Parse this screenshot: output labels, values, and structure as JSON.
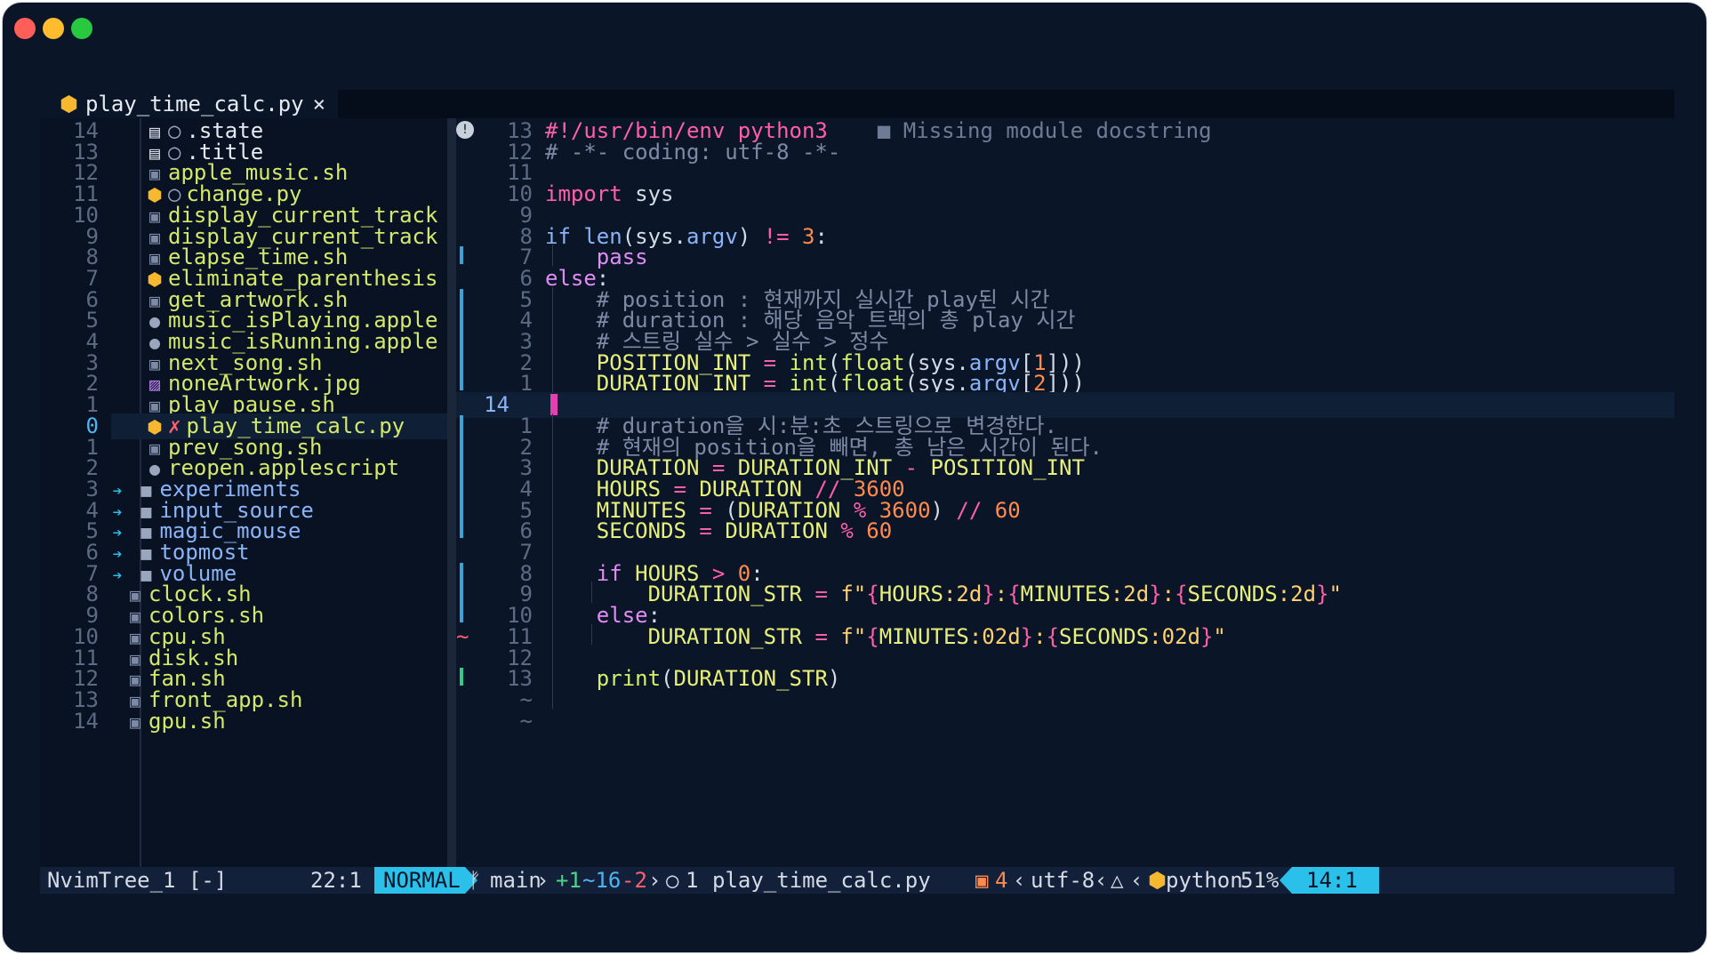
{
  "window": {
    "controls": [
      "close",
      "minimize",
      "zoom"
    ]
  },
  "tab": {
    "file": "play_time_calc.py",
    "close_icon": "×"
  },
  "tree": {
    "rows": [
      {
        "ln": "14",
        "icon": "file-icon",
        "git": "○",
        "name": ".state",
        "color": "#e6ebf2"
      },
      {
        "ln": "13",
        "icon": "file-icon",
        "git": "○",
        "name": ".title",
        "color": "#e6ebf2"
      },
      {
        "ln": "12",
        "icon": "terminal-icon",
        "git": "",
        "name": "apple_music.sh",
        "color": "#d4e86a"
      },
      {
        "ln": "11",
        "icon": "python-icon",
        "git": "○",
        "name": "change.py",
        "color": "#d4e86a"
      },
      {
        "ln": "10",
        "icon": "terminal-icon",
        "git": "",
        "name": "display_current_track",
        "color": "#d4e86a"
      },
      {
        "ln": "9",
        "icon": "terminal-icon",
        "git": "",
        "name": "display_current_track",
        "color": "#d4e86a"
      },
      {
        "ln": "8",
        "icon": "terminal-icon",
        "git": "",
        "name": "elapse_time.sh",
        "color": "#d4e86a"
      },
      {
        "ln": "7",
        "icon": "python-icon",
        "git": "",
        "name": "eliminate_parenthesis",
        "color": "#d4e86a"
      },
      {
        "ln": "6",
        "icon": "terminal-icon",
        "git": "",
        "name": "get_artwork.sh",
        "color": "#d4e86a"
      },
      {
        "ln": "5",
        "icon": "apple-icon",
        "git": "",
        "name": "music_isPlaying.apple",
        "color": "#d4e86a"
      },
      {
        "ln": "4",
        "icon": "apple-icon",
        "git": "",
        "name": "music_isRunning.apple",
        "color": "#d4e86a"
      },
      {
        "ln": "3",
        "icon": "terminal-icon",
        "git": "",
        "name": "next_song.sh",
        "color": "#d4e86a"
      },
      {
        "ln": "2",
        "icon": "image-icon",
        "git": "",
        "name": "noneArtwork.jpg",
        "color": "#d4e86a"
      },
      {
        "ln": "1",
        "icon": "terminal-icon",
        "git": "",
        "name": "play_pause.sh",
        "color": "#d4e86a"
      },
      {
        "ln": "0",
        "icon": "python-icon",
        "git": "✗",
        "name": "play_time_calc.py",
        "color": "#d4e86a",
        "selected": true
      },
      {
        "ln": "1",
        "icon": "terminal-icon",
        "git": "",
        "name": "prev_song.sh",
        "color": "#d4e86a"
      },
      {
        "ln": "2",
        "icon": "apple-icon",
        "git": "",
        "name": "reopen.applescript",
        "color": "#d4e86a"
      },
      {
        "ln": "3",
        "icon": "folder-icon",
        "git": "",
        "name": "experiments",
        "color": "#8ab4f8",
        "dir": true
      },
      {
        "ln": "4",
        "icon": "folder-icon",
        "git": "",
        "name": "input_source",
        "color": "#8ab4f8",
        "dir": true
      },
      {
        "ln": "5",
        "icon": "folder-icon",
        "git": "",
        "name": "magic_mouse",
        "color": "#8ab4f8",
        "dir": true
      },
      {
        "ln": "6",
        "icon": "folder-icon",
        "git": "",
        "name": "topmost",
        "color": "#8ab4f8",
        "dir": true
      },
      {
        "ln": "7",
        "icon": "folder-icon",
        "git": "",
        "name": "volume",
        "color": "#8ab4f8",
        "dir": true
      },
      {
        "ln": "8",
        "icon": "terminal-icon",
        "git": "",
        "name": "clock.sh",
        "color": "#d4e86a",
        "top": true
      },
      {
        "ln": "9",
        "icon": "terminal-icon",
        "git": "",
        "name": "colors.sh",
        "color": "#d4e86a",
        "top": true
      },
      {
        "ln": "10",
        "icon": "terminal-icon",
        "git": "",
        "name": "cpu.sh",
        "color": "#d4e86a",
        "top": true
      },
      {
        "ln": "11",
        "icon": "terminal-icon",
        "git": "",
        "name": "disk.sh",
        "color": "#d4e86a",
        "top": true
      },
      {
        "ln": "12",
        "icon": "terminal-icon",
        "git": "",
        "name": "fan.sh",
        "color": "#d4e86a",
        "top": true
      },
      {
        "ln": "13",
        "icon": "terminal-icon",
        "git": "",
        "name": "front_app.sh",
        "color": "#d4e86a",
        "top": true
      },
      {
        "ln": "14",
        "icon": "terminal-icon",
        "git": "",
        "name": "gpu.sh",
        "color": "#d4e86a",
        "top": true
      }
    ],
    "status_name": "NvimTree_1 [-]",
    "status_pos": "22:1"
  },
  "editor": {
    "lines": [
      {
        "ln": "13",
        "tokens": [
          [
            "#!/usr/bin/env python3",
            "k"
          ]
        ],
        "diag": "■ Missing module docstring"
      },
      {
        "ln": "12",
        "tokens": [
          [
            "# -*- coding: utf-8 -*-",
            "c"
          ]
        ]
      },
      {
        "ln": "11",
        "tokens": []
      },
      {
        "ln": "10",
        "tokens": [
          [
            "import",
            "k"
          ],
          [
            " sys",
            "w"
          ]
        ]
      },
      {
        "ln": "9",
        "tokens": []
      },
      {
        "ln": "8",
        "tokens": [
          [
            "if",
            "f"
          ],
          [
            " ",
            "w"
          ],
          [
            "len",
            "f"
          ],
          [
            "(sys.",
            "w"
          ],
          [
            "argv",
            "f"
          ],
          [
            ") ",
            "w"
          ],
          [
            "!=",
            "k"
          ],
          [
            " ",
            "w"
          ],
          [
            "3",
            "n"
          ],
          [
            ":",
            "w"
          ]
        ]
      },
      {
        "ln": "7",
        "tokens": [
          [
            "    pass",
            "m"
          ]
        ]
      },
      {
        "ln": "6",
        "tokens": [
          [
            "else",
            "m"
          ],
          [
            ":",
            "w"
          ]
        ]
      },
      {
        "ln": "5",
        "tokens": [
          [
            "    # position : 현재까지 실시간 play된 시간",
            "c"
          ]
        ]
      },
      {
        "ln": "4",
        "tokens": [
          [
            "    # duration : 해당 음악 트랙의 총 play 시간",
            "c"
          ]
        ]
      },
      {
        "ln": "3",
        "tokens": [
          [
            "    # 스트링 실수 > 실수 > 정수",
            "c"
          ]
        ]
      },
      {
        "ln": "2",
        "tokens": [
          [
            "    POSITION_INT",
            "y"
          ],
          [
            " ",
            "w"
          ],
          [
            "=",
            "k"
          ],
          [
            " ",
            "w"
          ],
          [
            "int",
            "s"
          ],
          [
            "(",
            "w"
          ],
          [
            "float",
            "s"
          ],
          [
            "(sys.",
            "w"
          ],
          [
            "argv",
            "f"
          ],
          [
            "[",
            "w"
          ],
          [
            "1",
            "n"
          ],
          [
            "]))",
            "w"
          ]
        ]
      },
      {
        "ln": "1",
        "tokens": [
          [
            "    DURATION_INT",
            "y"
          ],
          [
            " ",
            "w"
          ],
          [
            "=",
            "k"
          ],
          [
            " ",
            "w"
          ],
          [
            "int",
            "s"
          ],
          [
            "(",
            "w"
          ],
          [
            "float",
            "s"
          ],
          [
            "(sys.",
            "w"
          ],
          [
            "argv",
            "f"
          ],
          [
            "[",
            "w"
          ],
          [
            "2",
            "n"
          ],
          [
            "]))",
            "w"
          ]
        ]
      },
      {
        "ln": "14",
        "tokens": [],
        "current": true
      },
      {
        "ln": "1",
        "tokens": [
          [
            "    # duration을 시:분:초 스트링으로 변경한다.",
            "c"
          ]
        ]
      },
      {
        "ln": "2",
        "tokens": [
          [
            "    # 현재의 position을 빼면, 총 남은 시간이 된다.",
            "c"
          ]
        ]
      },
      {
        "ln": "3",
        "tokens": [
          [
            "    DURATION",
            "y"
          ],
          [
            " ",
            "w"
          ],
          [
            "=",
            "k"
          ],
          [
            " ",
            "w"
          ],
          [
            "DURATION_INT",
            "y"
          ],
          [
            " ",
            "w"
          ],
          [
            "-",
            "k"
          ],
          [
            " ",
            "w"
          ],
          [
            "POSITION_INT",
            "y"
          ]
        ]
      },
      {
        "ln": "4",
        "tokens": [
          [
            "    HOURS",
            "y"
          ],
          [
            " ",
            "w"
          ],
          [
            "=",
            "k"
          ],
          [
            " ",
            "w"
          ],
          [
            "DURATION",
            "y"
          ],
          [
            " ",
            "w"
          ],
          [
            "//",
            "k"
          ],
          [
            " ",
            "w"
          ],
          [
            "3600",
            "n"
          ]
        ]
      },
      {
        "ln": "5",
        "tokens": [
          [
            "    MINUTES",
            "y"
          ],
          [
            " ",
            "w"
          ],
          [
            "=",
            "k"
          ],
          [
            " (",
            "w"
          ],
          [
            "DURATION",
            "y"
          ],
          [
            " ",
            "w"
          ],
          [
            "%",
            "k"
          ],
          [
            " ",
            "w"
          ],
          [
            "3600",
            "n"
          ],
          [
            ") ",
            "w"
          ],
          [
            "//",
            "k"
          ],
          [
            " ",
            "w"
          ],
          [
            "60",
            "n"
          ]
        ]
      },
      {
        "ln": "6",
        "tokens": [
          [
            "    SECONDS",
            "y"
          ],
          [
            " ",
            "w"
          ],
          [
            "=",
            "k"
          ],
          [
            " ",
            "w"
          ],
          [
            "DURATION",
            "y"
          ],
          [
            " ",
            "w"
          ],
          [
            "%",
            "k"
          ],
          [
            " ",
            "w"
          ],
          [
            "60",
            "n"
          ]
        ]
      },
      {
        "ln": "7",
        "tokens": []
      },
      {
        "ln": "8",
        "tokens": [
          [
            "    if",
            "m"
          ],
          [
            " ",
            "w"
          ],
          [
            "HOURS",
            "y"
          ],
          [
            " ",
            "w"
          ],
          [
            ">",
            "k"
          ],
          [
            " ",
            "w"
          ],
          [
            "0",
            "n"
          ],
          [
            ":",
            "w"
          ]
        ]
      },
      {
        "ln": "9",
        "tokens": [
          [
            "        DURATION_STR",
            "y"
          ],
          [
            " ",
            "w"
          ],
          [
            "=",
            "k"
          ],
          [
            " ",
            "w"
          ],
          [
            "f\"",
            "p"
          ],
          [
            "{",
            "k"
          ],
          [
            "HOURS",
            "y"
          ],
          [
            ":2d",
            "p"
          ],
          [
            "}",
            "k"
          ],
          [
            ":",
            "p"
          ],
          [
            "{",
            "k"
          ],
          [
            "MINUTES",
            "y"
          ],
          [
            ":2d",
            "p"
          ],
          [
            "}",
            "k"
          ],
          [
            ":",
            "p"
          ],
          [
            "{",
            "k"
          ],
          [
            "SECONDS",
            "y"
          ],
          [
            ":2d",
            "p"
          ],
          [
            "}",
            "k"
          ],
          [
            "\"",
            "p"
          ]
        ]
      },
      {
        "ln": "10",
        "tokens": [
          [
            "    else",
            "m"
          ],
          [
            ":",
            "w"
          ]
        ]
      },
      {
        "ln": "11",
        "tokens": [
          [
            "        DURATION_STR",
            "y"
          ],
          [
            " ",
            "w"
          ],
          [
            "=",
            "k"
          ],
          [
            " ",
            "w"
          ],
          [
            "f\"",
            "p"
          ],
          [
            "{",
            "k"
          ],
          [
            "MINUTES",
            "y"
          ],
          [
            ":02d",
            "p"
          ],
          [
            "}",
            "k"
          ],
          [
            ":",
            "p"
          ],
          [
            "{",
            "k"
          ],
          [
            "SECONDS",
            "y"
          ],
          [
            ":02d",
            "p"
          ],
          [
            "}",
            "k"
          ],
          [
            "\"",
            "p"
          ]
        ]
      },
      {
        "ln": "12",
        "tokens": []
      },
      {
        "ln": "13",
        "tokens": [
          [
            "    print",
            "s"
          ],
          [
            "(",
            "w"
          ],
          [
            "DURATION_STR",
            "y"
          ],
          [
            ")",
            "w"
          ]
        ]
      },
      {
        "ln": "~",
        "tokens": []
      },
      {
        "ln": "~",
        "tokens": []
      }
    ]
  },
  "statusline": {
    "mode": "NORMAL",
    "branch": "main",
    "added": "+1",
    "changed": "~16",
    "removed": "-2",
    "lsp_count": "1",
    "filename": "play_time_calc.py",
    "diag_count": "4",
    "encoding": "utf-8",
    "filetype": "python",
    "percent": "51%",
    "position": "14:1"
  },
  "colors": {
    "accent": "#2bc0ea",
    "background": "#0a1628",
    "mode_bg": "#2bc0ea"
  }
}
